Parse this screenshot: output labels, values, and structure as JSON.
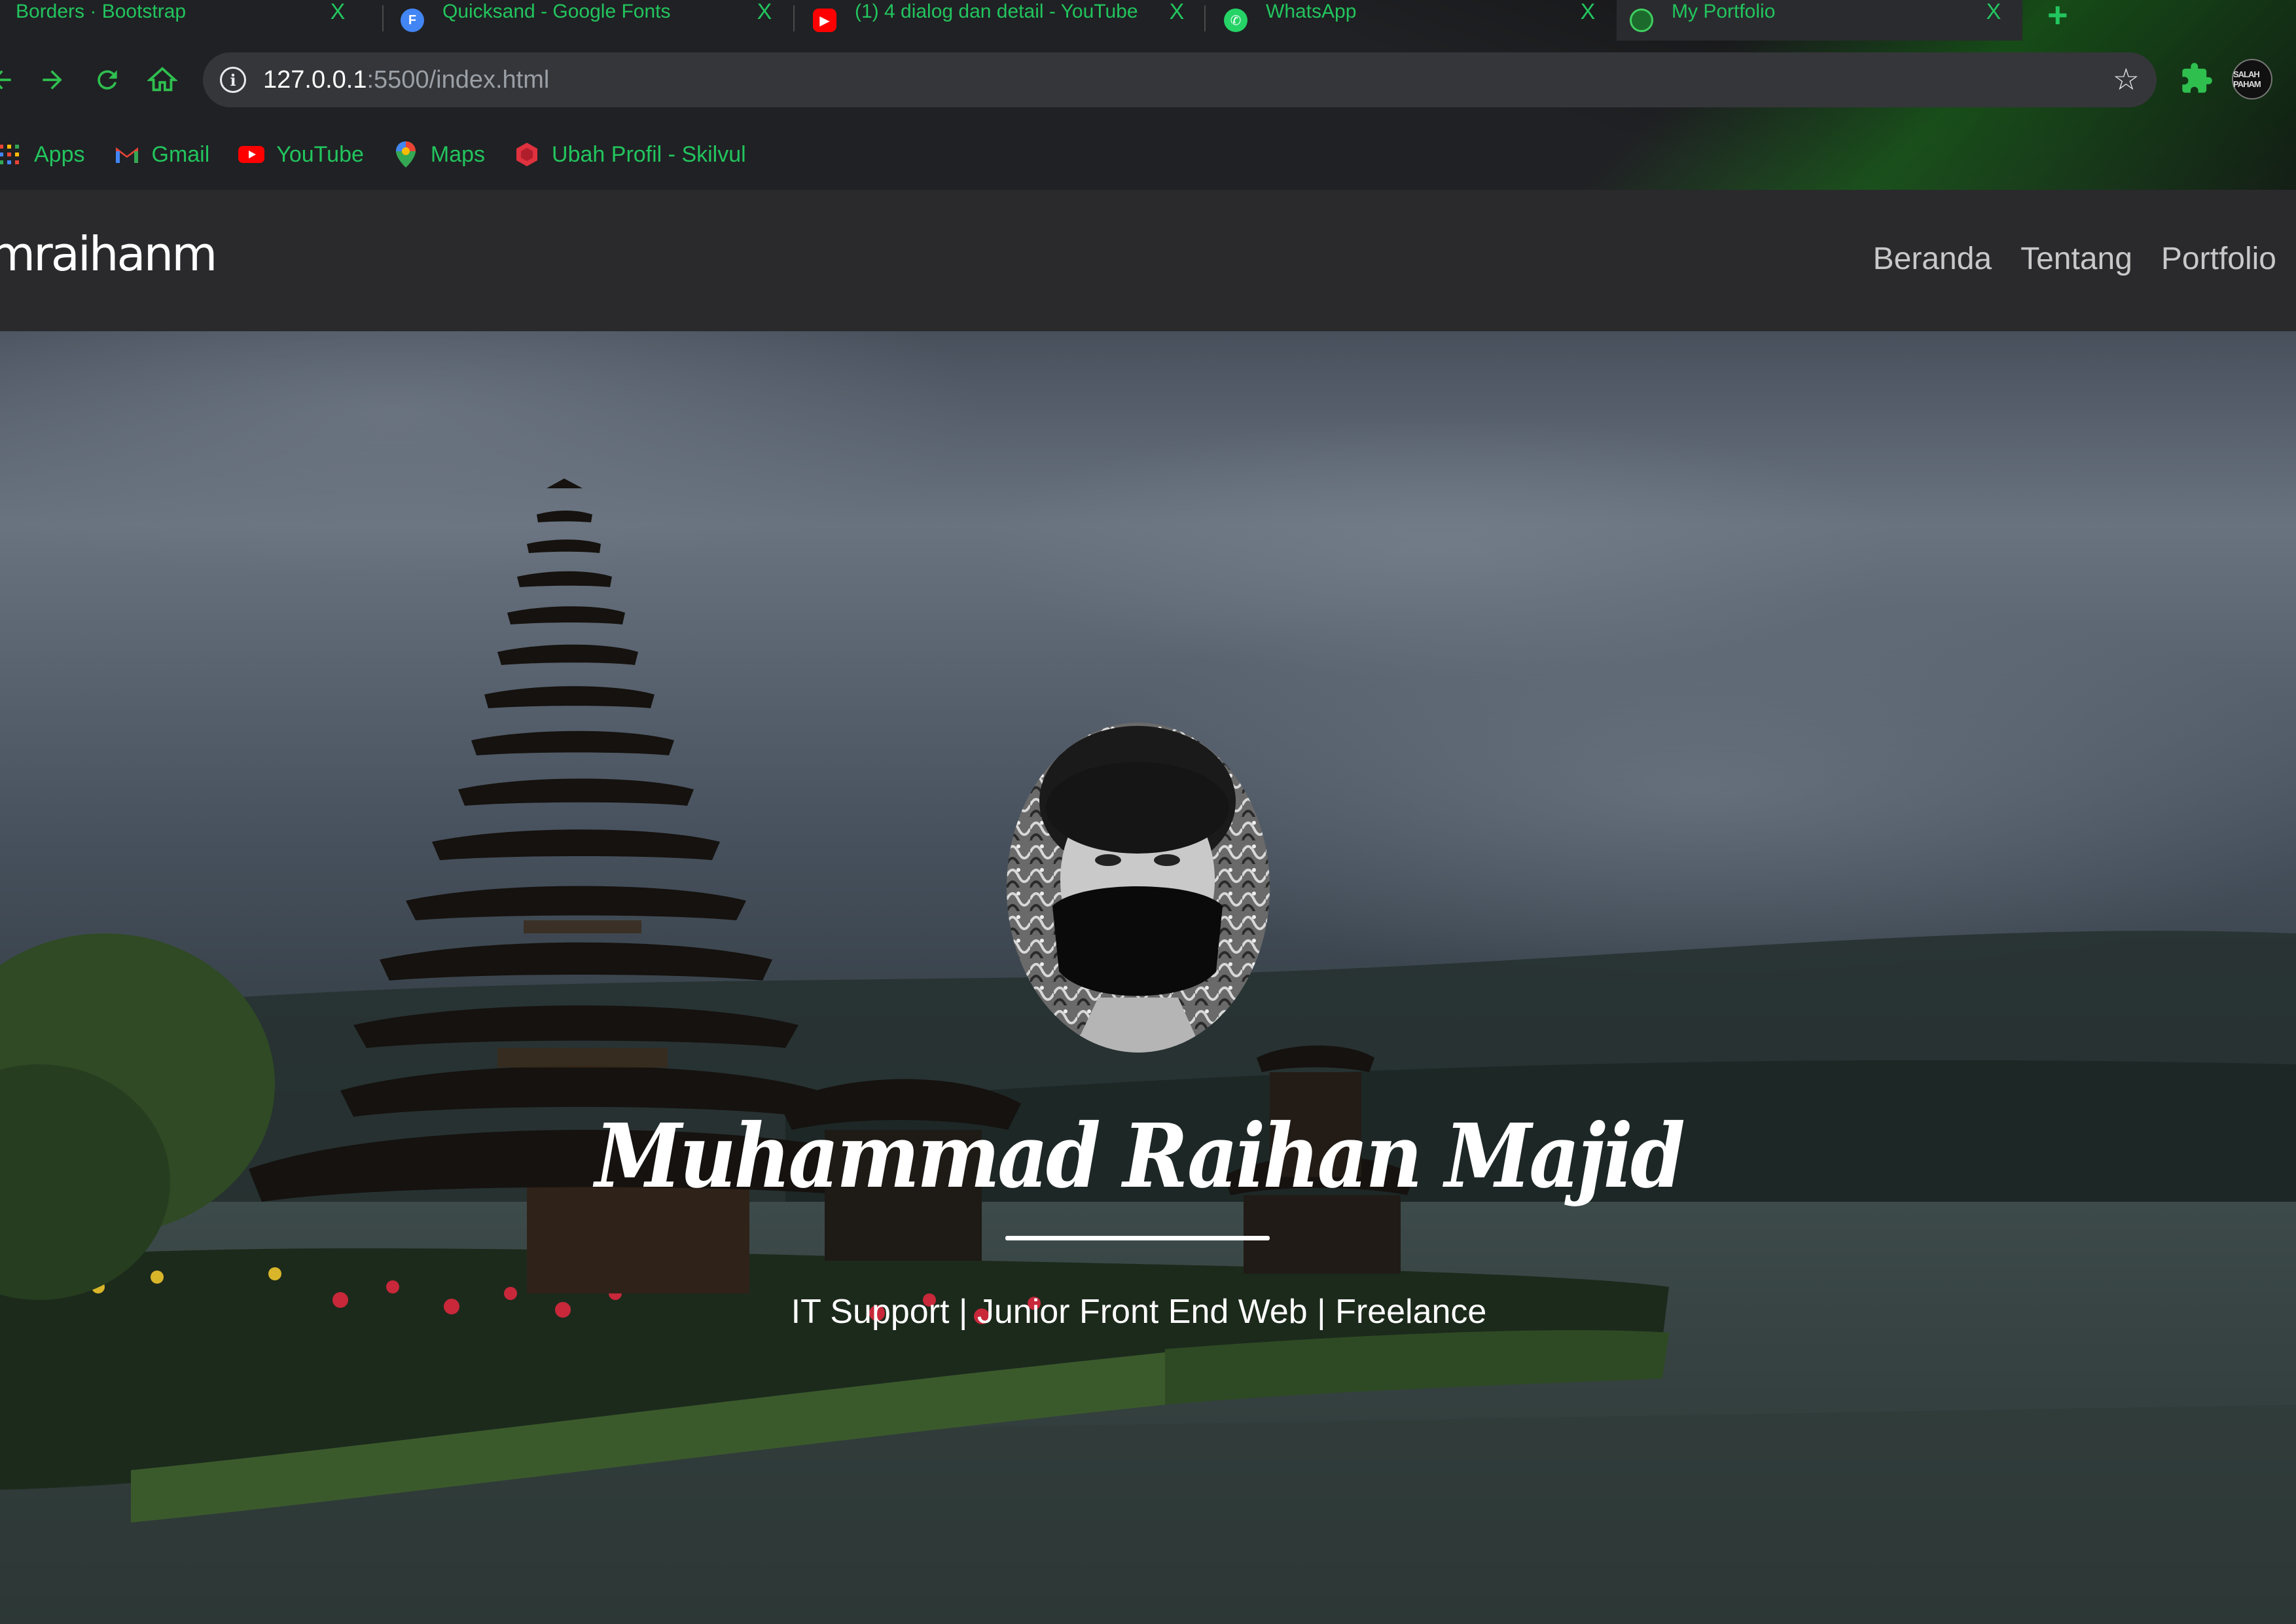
{
  "browser": {
    "tabs": [
      {
        "label": "Borders · Bootstrap",
        "favicon": "bootstrap-icon",
        "active": false
      },
      {
        "label": "Quicksand - Google Fonts",
        "favicon": "google-fonts-icon",
        "active": false
      },
      {
        "label": "(1) 4 dialog dan detail - YouTube",
        "favicon": "youtube-icon",
        "active": false
      },
      {
        "label": "WhatsApp",
        "favicon": "whatsapp-icon",
        "active": false
      },
      {
        "label": "My Portfolio",
        "favicon": "globe-icon",
        "active": true
      }
    ],
    "tab_close_glyph": "X",
    "new_tab_glyph": "+",
    "address_bar": {
      "host": "127.0.0.1",
      "path": ":5500/index.html"
    },
    "profile_badge": "SALAH PAHAM",
    "accent_color": "#22c55e"
  },
  "bookmarks": [
    {
      "label": "Apps",
      "icon": "apps-grid-icon"
    },
    {
      "label": "Gmail",
      "icon": "gmail-icon"
    },
    {
      "label": "YouTube",
      "icon": "youtube-icon"
    },
    {
      "label": "Maps",
      "icon": "maps-pin-icon"
    },
    {
      "label": "Ubah Profil - Skilvul",
      "icon": "skilvul-icon"
    }
  ],
  "site": {
    "brand": "mraihanm",
    "nav": [
      "Beranda",
      "Tentang",
      "Portfolio"
    ],
    "hero": {
      "name": "Muhammad Raihan Majid",
      "tagline": "IT Support | Junior Front End Web | Freelance"
    }
  }
}
